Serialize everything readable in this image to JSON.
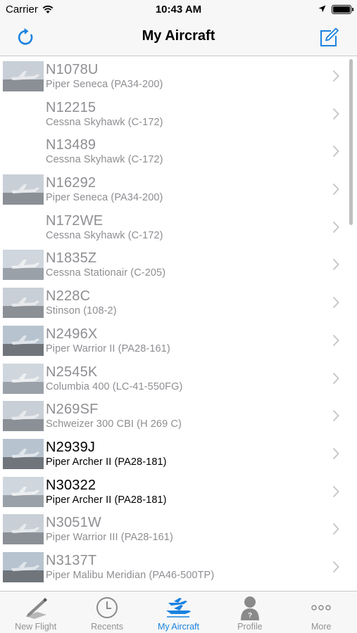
{
  "status_bar": {
    "carrier": "Carrier",
    "time": "10:43 AM"
  },
  "nav": {
    "title": "My Aircraft",
    "left_icon": "refresh-icon",
    "right_icon": "compose-icon"
  },
  "aircraft": [
    {
      "reg": "N1078U",
      "model": "Piper Seneca (PA34-200)",
      "has_photo": true,
      "active": false
    },
    {
      "reg": "N12215",
      "model": "Cessna Skyhawk (C-172)",
      "has_photo": false,
      "active": false
    },
    {
      "reg": "N13489",
      "model": "Cessna Skyhawk (C-172)",
      "has_photo": false,
      "active": false
    },
    {
      "reg": "N16292",
      "model": "Piper Seneca (PA34-200)",
      "has_photo": true,
      "active": false
    },
    {
      "reg": "N172WE",
      "model": "Cessna Skyhawk (C-172)",
      "has_photo": false,
      "active": false
    },
    {
      "reg": "N1835Z",
      "model": "Cessna Stationair (C-205)",
      "has_photo": true,
      "active": false
    },
    {
      "reg": "N228C",
      "model": "Stinson  (108-2)",
      "has_photo": true,
      "active": false
    },
    {
      "reg": "N2496X",
      "model": "Piper Warrior II (PA28-161)",
      "has_photo": true,
      "active": false
    },
    {
      "reg": "N2545K",
      "model": "Columbia 400 (LC-41-550FG)",
      "has_photo": true,
      "active": false
    },
    {
      "reg": "N269SF",
      "model": "Schweizer 300 CBI (H 269 C)",
      "has_photo": true,
      "active": false
    },
    {
      "reg": "N2939J",
      "model": "Piper Archer II (PA28-181)",
      "has_photo": true,
      "active": true
    },
    {
      "reg": "N30322",
      "model": "Piper Archer II (PA28-181)",
      "has_photo": true,
      "active": true
    },
    {
      "reg": "N3051W",
      "model": "Piper Warrior III (PA28-161)",
      "has_photo": true,
      "active": false
    },
    {
      "reg": "N3137T",
      "model": "Piper Malibu Meridian (PA46-500TP)",
      "has_photo": true,
      "active": false
    }
  ],
  "tabs": [
    {
      "label": "New Flight",
      "icon": "pen-logbook-icon",
      "active": false
    },
    {
      "label": "Recents",
      "icon": "clock-icon",
      "active": false
    },
    {
      "label": "My Aircraft",
      "icon": "airplane-icon",
      "active": true
    },
    {
      "label": "Profile",
      "icon": "person-icon",
      "active": false
    },
    {
      "label": "More",
      "icon": "more-dots-icon",
      "active": false
    }
  ],
  "colors": {
    "accent": "#1a82e0",
    "inactive_text": "#8e8e93",
    "bar_bg": "#f7f7f7"
  }
}
